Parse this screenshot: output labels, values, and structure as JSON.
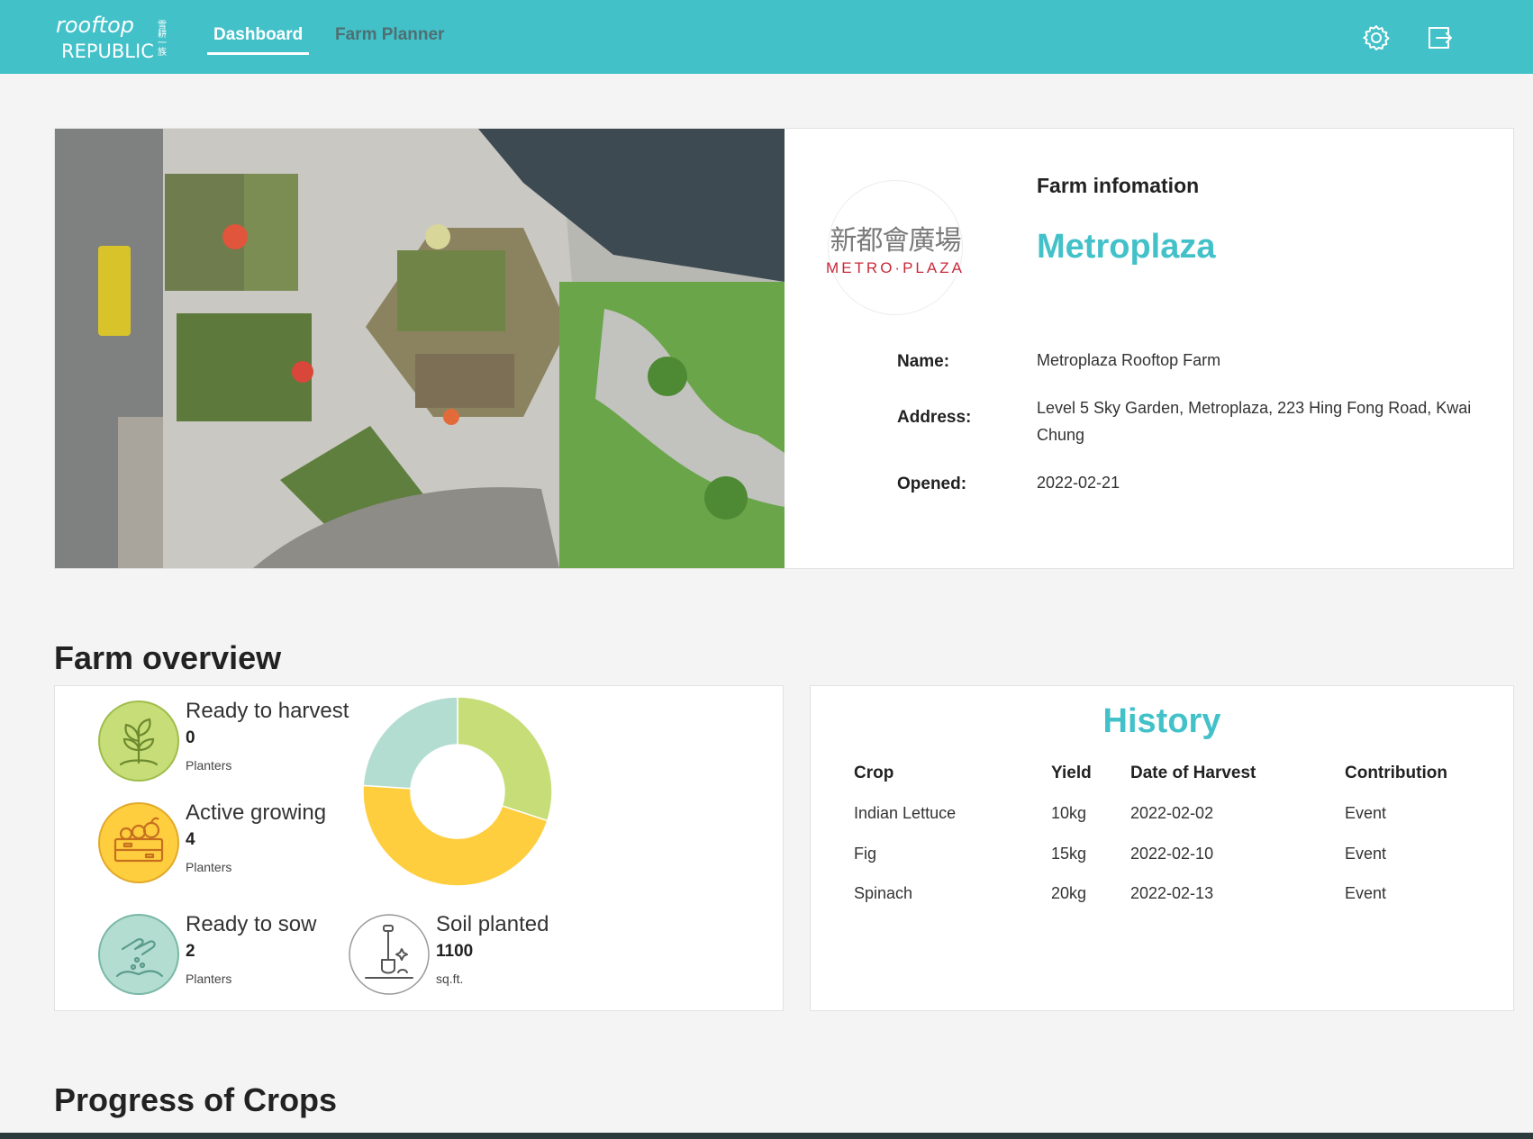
{
  "colors": {
    "brand_teal": "#43c1c9",
    "harvest_green": "#c7dd78",
    "growing_yellow": "#fece3f",
    "sow_mint": "#b3ddd1"
  },
  "nav": {
    "logo_line1": "rooftop",
    "logo_line2": "REPUBLIC",
    "logo_zh": "雪耕一族",
    "dashboard": "Dashboard",
    "farm_planner": "Farm Planner",
    "icons": [
      "gear-icon",
      "logout-icon"
    ]
  },
  "farm_info": {
    "subtitle": "Farm infomation",
    "title": "Metroplaza",
    "brand_zh": "新都會廣場",
    "brand_en": "METRO·PLAZA",
    "name_label": "Name:",
    "name_value": "Metroplaza Rooftop Farm",
    "address_label": "Address:",
    "address_value": "Level 5 Sky Garden, Metroplaza, 223 Hing Fong Road, Kwai Chung",
    "opened_label": "Opened:",
    "opened_value": "2022-02-21"
  },
  "overview": {
    "title": "Farm overview",
    "harvest": {
      "label": "Ready to harvest",
      "value": "0",
      "unit": "Planters",
      "icon": "seedling-icon"
    },
    "growing": {
      "label": "Active growing",
      "value": "4",
      "unit": "Planters",
      "icon": "crate-icon"
    },
    "sow": {
      "label": "Ready to sow",
      "value": "2",
      "unit": "Planters",
      "icon": "sowing-hand-icon"
    },
    "soil": {
      "label": "Soil planted",
      "value": "1100",
      "unit": "sq.ft.",
      "icon": "shovel-icon"
    }
  },
  "chart_data": {
    "type": "pie",
    "categories": [
      "Ready to harvest",
      "Active growing",
      "Ready to sow"
    ],
    "values": [
      30,
      46,
      24
    ],
    "colors": [
      "#c7dd78",
      "#fece3f",
      "#b3ddd1"
    ]
  },
  "history": {
    "title": "History",
    "headers": [
      "Crop",
      "Yield",
      "Date of Harvest",
      "Contribution"
    ],
    "rows": [
      [
        "Indian Lettuce",
        "10kg",
        "2022-02-02",
        "Event"
      ],
      [
        "Fig",
        "15kg",
        "2022-02-10",
        "Event"
      ],
      [
        "Spinach",
        "20kg",
        "2022-02-13",
        "Event"
      ]
    ]
  },
  "progress": {
    "title": "Progress of Crops"
  }
}
